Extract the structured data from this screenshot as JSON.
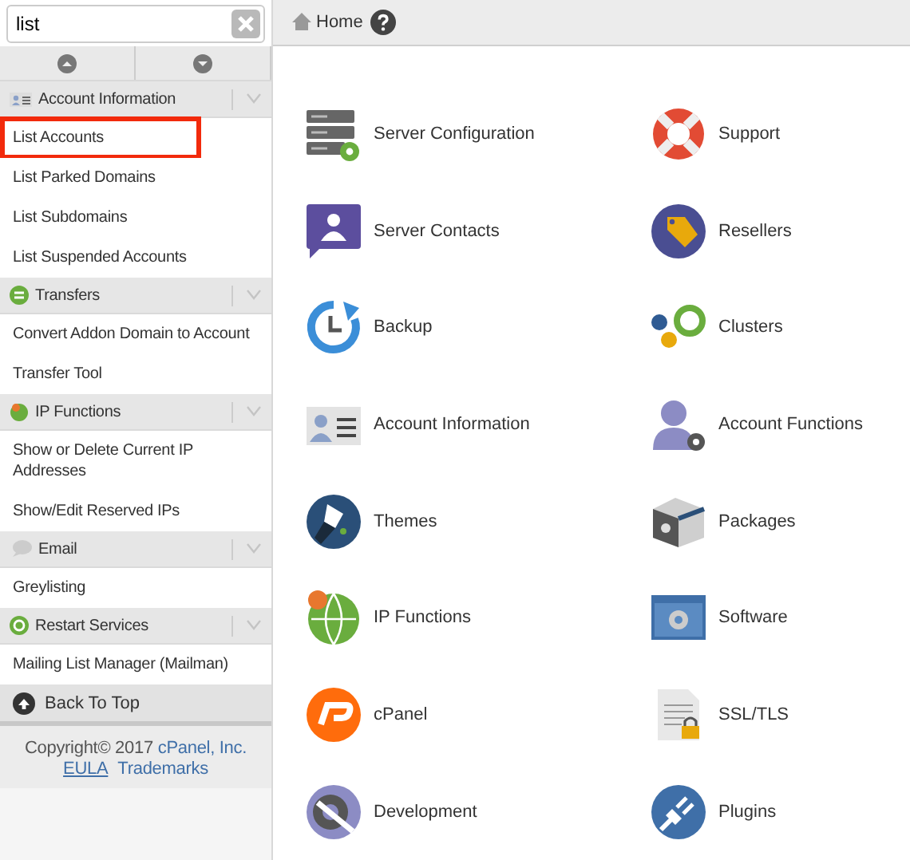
{
  "search": {
    "value": "list"
  },
  "sidebar": [
    {
      "kind": "header",
      "label": "Account Information"
    },
    {
      "kind": "item",
      "label": "List Accounts",
      "highlighted": true
    },
    {
      "kind": "item",
      "label": "List Parked Domains",
      "highlighted": false
    },
    {
      "kind": "item",
      "label": "List Subdomains",
      "highlighted": false
    },
    {
      "kind": "item",
      "label": "List Suspended Accounts",
      "highlighted": false
    },
    {
      "kind": "header",
      "label": "Transfers"
    },
    {
      "kind": "item",
      "label": "Convert Addon Domain to Account",
      "highlighted": false
    },
    {
      "kind": "item",
      "label": "Transfer Tool",
      "highlighted": false
    },
    {
      "kind": "header",
      "label": "IP Functions"
    },
    {
      "kind": "item",
      "label": "Show or Delete Current IP Addresses",
      "highlighted": false
    },
    {
      "kind": "item",
      "label": "Show/Edit Reserved IPs",
      "highlighted": false
    },
    {
      "kind": "header",
      "label": "Email"
    },
    {
      "kind": "item",
      "label": "Greylisting",
      "highlighted": false
    },
    {
      "kind": "header",
      "label": "Restart Services"
    },
    {
      "kind": "item",
      "label": "Mailing List Manager (Mailman)",
      "highlighted": false
    }
  ],
  "back_to_top": "Back To Top",
  "footer": {
    "copyright": "Copyright© 2017",
    "company": "cPanel, Inc.",
    "links": [
      "EULA",
      "Trademarks"
    ]
  },
  "breadcrumb": "Home",
  "tiles": [
    "Server Configuration",
    "Support",
    "Server Contacts",
    "Resellers",
    "Backup",
    "Clusters",
    "Account Information",
    "Account Functions",
    "Themes",
    "Packages",
    "IP Functions",
    "Software",
    "cPanel",
    "SSL/TLS",
    "Development",
    "Plugins"
  ]
}
